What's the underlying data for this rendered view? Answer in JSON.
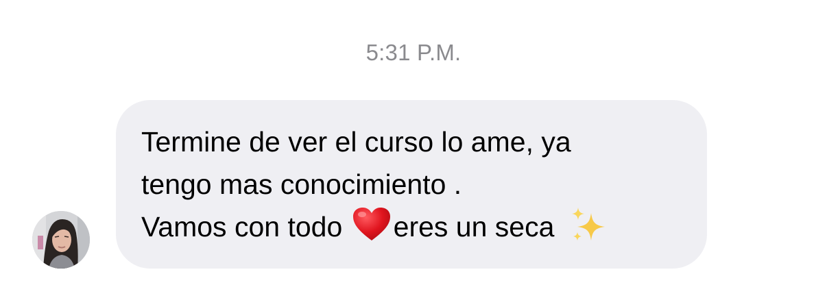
{
  "conversation": {
    "timestamp": "5:31 P.M."
  },
  "message": {
    "sender_avatar": "profile-photo",
    "line_1": "Termine de ver el curso lo ame, ya",
    "line_2": "tengo mas conocimiento .",
    "line_3_part_1": "Vamos con todo ",
    "emoji_1": "red-heart",
    "line_3_part_2": "eres un seca ",
    "emoji_2": "sparkles",
    "bubble_color": "#efeff3"
  }
}
